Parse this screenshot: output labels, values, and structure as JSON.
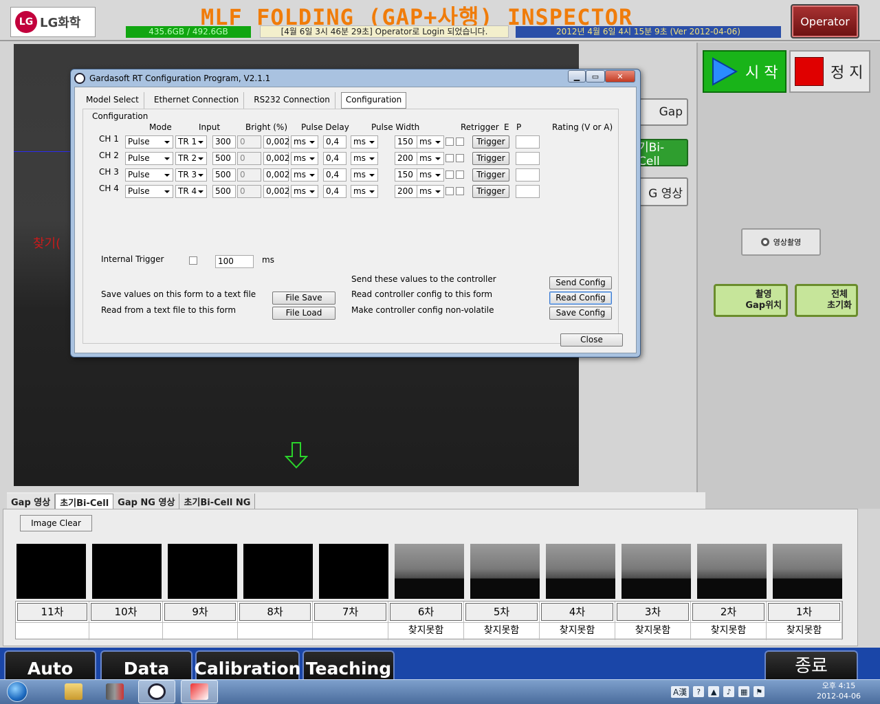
{
  "header": {
    "logo_text": "LG화학",
    "logo_mark": "LG",
    "app_title": "MLF FOLDING (GAP+사행)  INSPECTOR",
    "disk_usage": "435.6GB / 492.6GB",
    "login_message": "[4월 6일 3시 46분 29초]  Operator로 Login 되었습니다.",
    "datetime_version": "2012년 4월 6일 4시 15분 9초 (Ver 2012-04-06)",
    "operator_button": "Operator"
  },
  "camera": {
    "overlay_text": "찾기(",
    "arrow_color": "#2bd42b"
  },
  "right_panel": {
    "start_label": "시 작",
    "stop_label": "정 지",
    "gap_view_label": "Gap",
    "bicell_label": "기Bi-Cell",
    "gapng_label": "G 영상",
    "capture_label": "영상촬영",
    "gap_pos_label_1": "촬영",
    "gap_pos_label_2": "Gap위치",
    "reset_label_1": "전체",
    "reset_label_2": "초기화"
  },
  "image_tabs": [
    {
      "label": "Gap 영상",
      "active": false
    },
    {
      "label": "초기Bi-Cell",
      "active": true
    },
    {
      "label": "Gap NG 영상",
      "active": false
    },
    {
      "label": "초기Bi-Cell NG",
      "active": false
    }
  ],
  "image_clear_label": "Image Clear",
  "slots": [
    {
      "label": "11차",
      "status": "",
      "thumb": "black"
    },
    {
      "label": "10차",
      "status": "",
      "thumb": "black"
    },
    {
      "label": "9차",
      "status": "",
      "thumb": "black"
    },
    {
      "label": "8차",
      "status": "",
      "thumb": "black"
    },
    {
      "label": "7차",
      "status": "",
      "thumb": "black"
    },
    {
      "label": "6차",
      "status": "찾지못함",
      "thumb": "grad"
    },
    {
      "label": "5차",
      "status": "찾지못함",
      "thumb": "grad"
    },
    {
      "label": "4차",
      "status": "찾지못함",
      "thumb": "grad"
    },
    {
      "label": "3차",
      "status": "찾지못함",
      "thumb": "grad"
    },
    {
      "label": "2차",
      "status": "찾지못함",
      "thumb": "grad"
    },
    {
      "label": "1차",
      "status": "찾지못함",
      "thumb": "grad"
    }
  ],
  "nav": {
    "auto": "Auto",
    "data": "Data",
    "calibration": "Calibration",
    "teaching": "Teaching",
    "exit": "종료"
  },
  "taskbar": {
    "time": "오후 4:15",
    "date": "2012-04-06",
    "ime": "A漢"
  },
  "dialog": {
    "title": "Gardasoft RT Configuration Program, V2.1.1",
    "tabs": [
      "Model Select",
      "Ethernet Connection",
      "RS232 Connection",
      "Configuration"
    ],
    "active_tab": "Configuration",
    "group_label": "Configuration",
    "columns": {
      "mode": "Mode",
      "input": "Input",
      "bright": "Bright (%)",
      "pulse_delay": "Pulse Delay",
      "pulse_width": "Pulse Width",
      "retrigger": "Retrigger",
      "e": "E",
      "p": "P",
      "rating": "Rating (V or A)"
    },
    "channels": [
      {
        "name": "CH 1",
        "mode": "Pulse",
        "input": "TR 1",
        "bright": "300",
        "dis": "0",
        "delay": "0,002",
        "delay_unit": "ms",
        "retrig": "0,4",
        "retrig_unit": "ms",
        "width": "150",
        "width_unit": "ms",
        "trigger": "Trigger",
        "rating": ""
      },
      {
        "name": "CH 2",
        "mode": "Pulse",
        "input": "TR 2",
        "bright": "500",
        "dis": "0",
        "delay": "0,002",
        "delay_unit": "ms",
        "retrig": "0,4",
        "retrig_unit": "ms",
        "width": "200",
        "width_unit": "ms",
        "trigger": "Trigger",
        "rating": ""
      },
      {
        "name": "CH 3",
        "mode": "Pulse",
        "input": "TR 3",
        "bright": "500",
        "dis": "0",
        "delay": "0,002",
        "delay_unit": "ms",
        "retrig": "0,4",
        "retrig_unit": "ms",
        "width": "150",
        "width_unit": "ms",
        "trigger": "Trigger",
        "rating": ""
      },
      {
        "name": "CH 4",
        "mode": "Pulse",
        "input": "TR 4",
        "bright": "500",
        "dis": "0",
        "delay": "0,002",
        "delay_unit": "ms",
        "retrig": "0,4",
        "retrig_unit": "ms",
        "width": "200",
        "width_unit": "ms",
        "trigger": "Trigger",
        "rating": ""
      }
    ],
    "internal_trigger_label": "Internal Trigger",
    "internal_trigger_value": "100",
    "internal_trigger_unit": "ms",
    "save_text": "Save values on this form to a text file",
    "read_text": "Read from a text file to this form",
    "file_save": "File Save",
    "file_load": "File Load",
    "send_text": "Send these values to the controller",
    "read_ctrl_text": "Read controller config to this form",
    "nonvol_text": "Make controller config non-volatile",
    "send_config": "Send Config",
    "read_config": "Read Config",
    "save_config": "Save Config",
    "close": "Close"
  }
}
